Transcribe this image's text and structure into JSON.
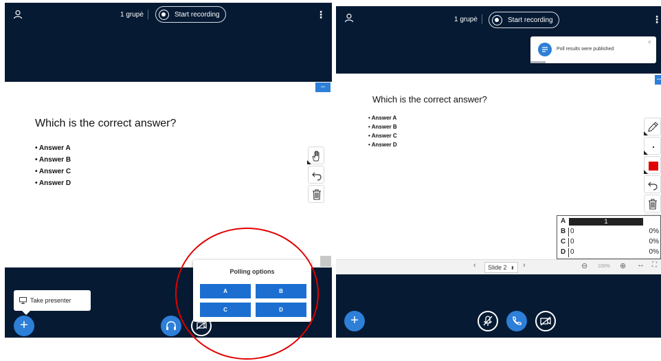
{
  "left": {
    "topbar": {
      "group_label": "1 grupė",
      "record_label": "Start recording"
    },
    "slide": {
      "question": "Which is the correct answer?",
      "answers": [
        "Answer A",
        "Answer B",
        "Answer C",
        "Answer D"
      ]
    },
    "take_presenter_label": "Take presenter",
    "polling": {
      "title": "Polling options",
      "options": [
        "A",
        "B",
        "C",
        "D"
      ]
    },
    "icons": [
      "user-icon",
      "record-icon",
      "kebab-icon",
      "hand-icon",
      "undo-icon",
      "trash-icon",
      "plus-icon",
      "headphones-icon",
      "screen-share-icon",
      "presenter-icon",
      "fullscreen-icon"
    ]
  },
  "right": {
    "topbar": {
      "group_label": "1 grupė",
      "record_label": "Start recording"
    },
    "toast": {
      "message": "Poll results were published",
      "close": "×"
    },
    "slide": {
      "question": "Which is the correct answer?",
      "answers": [
        "Answer A",
        "Answer B",
        "Answer C",
        "Answer D"
      ]
    },
    "poll_results": [
      {
        "label": "A",
        "count": "1",
        "percent": "",
        "fraction": 1.0
      },
      {
        "label": "B",
        "count": "0",
        "percent": "0%",
        "fraction": 0
      },
      {
        "label": "C",
        "count": "0",
        "percent": "0%",
        "fraction": 0
      },
      {
        "label": "D",
        "count": "0",
        "percent": "0%",
        "fraction": 0
      }
    ],
    "slide_nav": {
      "slide_label": "Slide 2",
      "zoom": "100%"
    },
    "accent_color": "#e10000"
  },
  "colors": {
    "bar_bg": "#061a33",
    "accent_blue": "#2d7fd8",
    "poll_blue": "#1c6fd1",
    "annotation_red": "#e10000"
  }
}
